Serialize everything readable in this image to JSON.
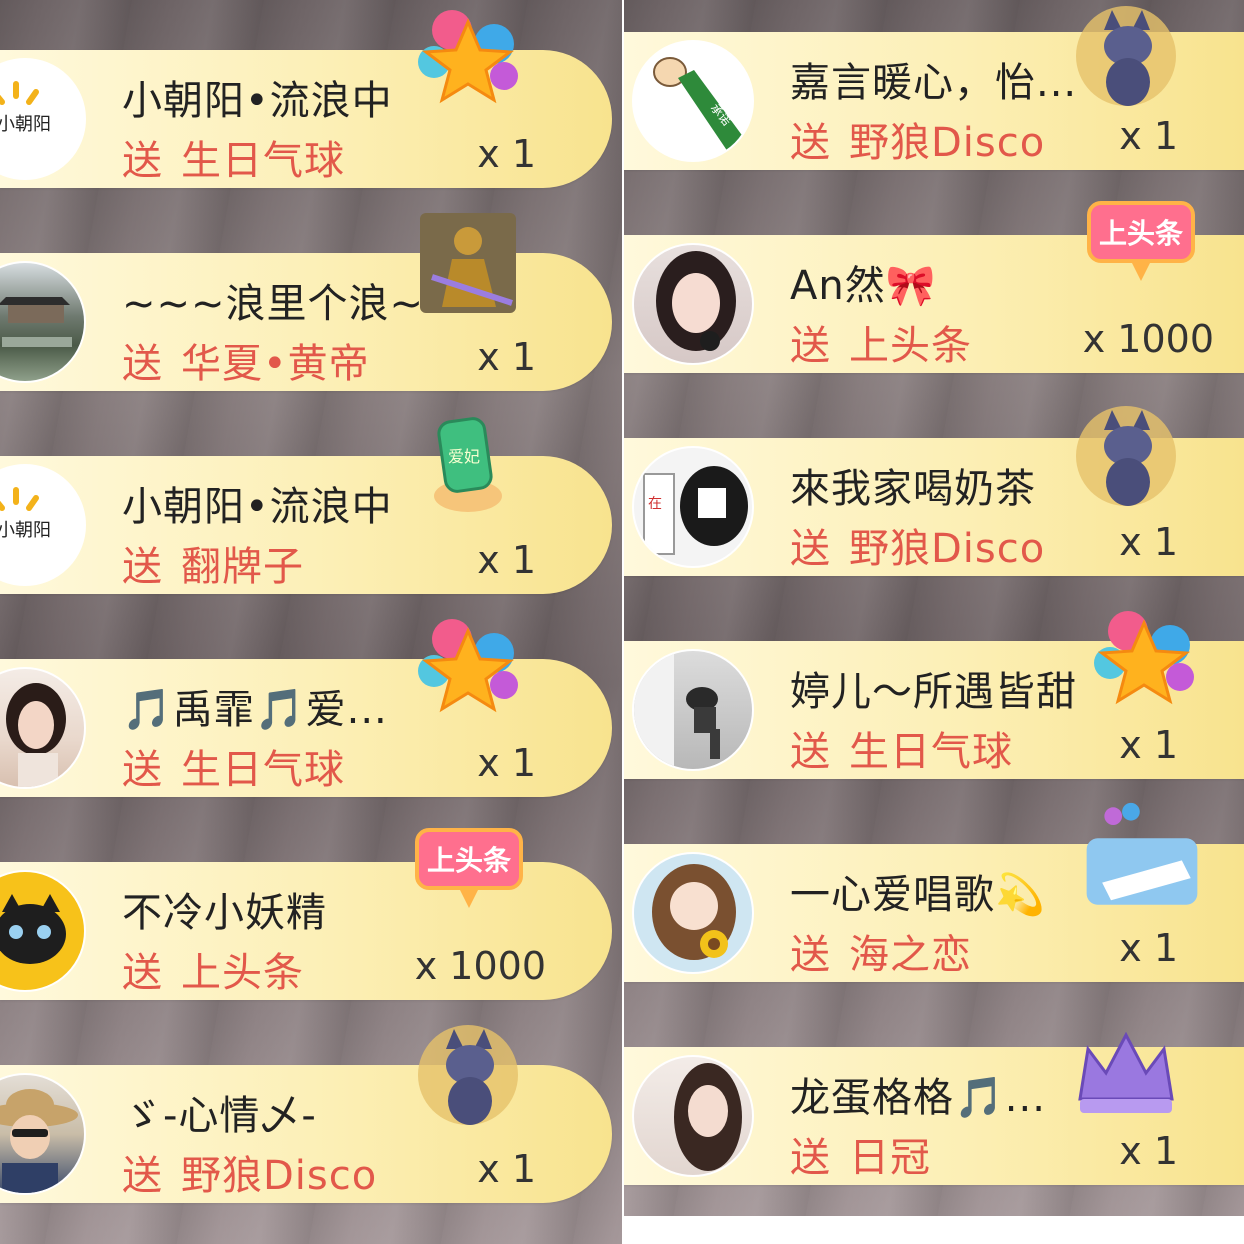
{
  "left_column": [
    {
      "name": "小朝阳•流浪中",
      "verb": "送",
      "gift": "生日气球",
      "qty": "x 1",
      "gift_icon": "birthday-balloon-icon",
      "avatar": "sun-logo-avatar",
      "avatar_text": "小朝阳"
    },
    {
      "name": "~~~浪里个浪~~",
      "verb": "送",
      "gift": "华夏•黄帝",
      "qty": "x 1",
      "gift_icon": "golden-emperor-icon",
      "avatar": "garden-pavilion-avatar"
    },
    {
      "name": "小朝阳•流浪中",
      "verb": "送",
      "gift": "翻牌子",
      "qty": "x 1",
      "gift_icon": "jade-tablet-icon",
      "avatar": "sun-logo-avatar",
      "avatar_text": "小朝阳",
      "gift_text": "爱妃"
    },
    {
      "name": "🎵禹霏🎵爱...",
      "verb": "送",
      "gift": "生日气球",
      "qty": "x 1",
      "gift_icon": "birthday-balloon-icon",
      "avatar": "woman-portrait-avatar"
    },
    {
      "name": "不冷小妖精",
      "verb": "送",
      "gift": "上头条",
      "qty": "x 1000",
      "gift_icon": "headline-badge-icon",
      "avatar": "black-cat-avatar",
      "gift_text": "上头条"
    },
    {
      "name": "ゞ-心情乄-",
      "verb": "送",
      "gift": "野狼Disco",
      "qty": "x 1",
      "gift_icon": "wolf-disco-icon",
      "avatar": "straw-hat-boy-avatar"
    }
  ],
  "right_column": [
    {
      "name": "嘉言暖心，怡...",
      "verb": "送",
      "gift": "野狼Disco",
      "qty": "x 1",
      "gift_icon": "wolf-disco-icon",
      "avatar": "waving-hand-avatar"
    },
    {
      "name": "An然🎀",
      "verb": "送",
      "gift": "上头条",
      "qty": "x 1000",
      "gift_icon": "headline-badge-icon",
      "avatar": "girl-portrait-avatar",
      "gift_text": "上头条"
    },
    {
      "name": "來我家喝奶茶",
      "verb": "送",
      "gift": "野狼Disco",
      "qty": "x 1",
      "gift_icon": "wolf-disco-icon",
      "avatar": "black-hood-avatar"
    },
    {
      "name": "婷儿～所遇皆甜",
      "verb": "送",
      "gift": "生日气球",
      "qty": "x 1",
      "gift_icon": "birthday-balloon-icon",
      "avatar": "dancer-photo-avatar"
    },
    {
      "name": "一心爱唱歌💫",
      "verb": "送",
      "gift": "海之恋",
      "qty": "x 1",
      "gift_icon": "sea-ship-icon",
      "avatar": "sunflower-girl-avatar"
    },
    {
      "name": "龙蛋格格🎵...",
      "verb": "送",
      "gift": "日冠",
      "qty": "x 1",
      "gift_icon": "purple-crown-icon",
      "avatar": "long-hair-girl-avatar"
    }
  ],
  "colors": {
    "card": "#fcefb5",
    "name_text": "#222222",
    "gift_text": "#e2584a",
    "qty_text": "#333333"
  }
}
